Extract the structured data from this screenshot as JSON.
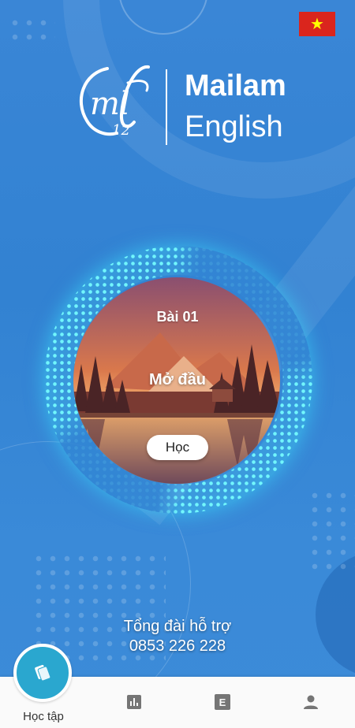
{
  "app": {
    "brand_name": "Mailam",
    "brand_sub": "English",
    "logo_monogram": "ml",
    "logo_small": "12",
    "language_flag_icon": "vietnam-flag-icon",
    "flag_star": "★"
  },
  "lesson": {
    "number_label": "Bài 01",
    "title": "Mở đầu",
    "action_label": "Học"
  },
  "support": {
    "title": "Tổng đài hỗ trợ",
    "phone": "0853 226 228"
  },
  "bottom_nav": {
    "items": [
      {
        "label": "Học tập",
        "icon": "cards-icon",
        "active": true
      },
      {
        "label": "",
        "icon": "bar-chart-icon",
        "active": false
      },
      {
        "label": "",
        "icon": "letter-e-icon",
        "active": false
      },
      {
        "label": "",
        "icon": "user-icon",
        "active": false
      }
    ],
    "letter_e": "E"
  },
  "colors": {
    "background": "#3282d2",
    "ring_glow": "#4fe9ff",
    "active_nav": "#2aa7cf",
    "nav_icon_gray": "#757575"
  }
}
